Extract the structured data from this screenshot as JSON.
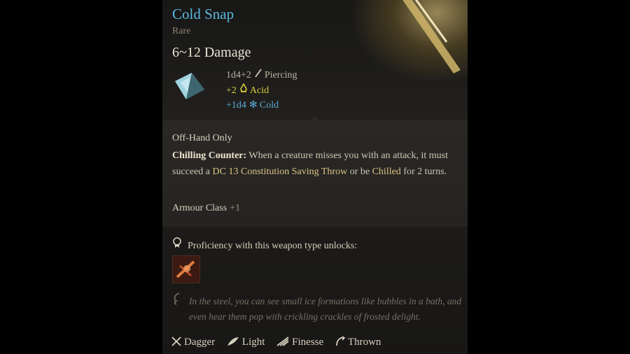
{
  "item": {
    "name": "Cold Snap",
    "rarity": "Rare",
    "damage_range": "6~12 Damage",
    "damage_rows": [
      {
        "dice": "1d4+2",
        "icon": "piercing-icon",
        "type": "Piercing"
      },
      {
        "dice": "+2",
        "icon": "acid-icon",
        "type": "Acid"
      },
      {
        "dice": "+1d4",
        "icon": "cold-snowflake-icon",
        "type": "Cold"
      }
    ]
  },
  "details": {
    "slot": "Off-Hand Only",
    "ability_name": "Chilling Counter:",
    "desc_1": " When a creature misses you with an attack, it must succeed a ",
    "save_dc": "DC 13 Constitution Saving Throw",
    "desc_2": " or be ",
    "condition": "Chilled",
    "desc_3": " for 2 turns.",
    "armour_label": "Armour Class",
    "armour_value": "+1"
  },
  "proficiency": {
    "label": "Proficiency with this weapon type unlocks:",
    "skill_icon": "weapon-action-icon"
  },
  "flavor": "In the steel, you can see small ice formations like bubbles in a bath, and even hear them pop with crickling crackles of frosted delight.",
  "properties": [
    {
      "icon": "dagger-icon",
      "label": "Dagger"
    },
    {
      "icon": "light-feather-icon",
      "label": "Light"
    },
    {
      "icon": "finesse-icon",
      "label": "Finesse"
    },
    {
      "icon": "thrown-icon",
      "label": "Thrown"
    }
  ],
  "colors": {
    "title": "#5ab7dc",
    "acid": "#d8ce3c",
    "cold": "#5aaad8",
    "highlight": "#d9c486"
  }
}
